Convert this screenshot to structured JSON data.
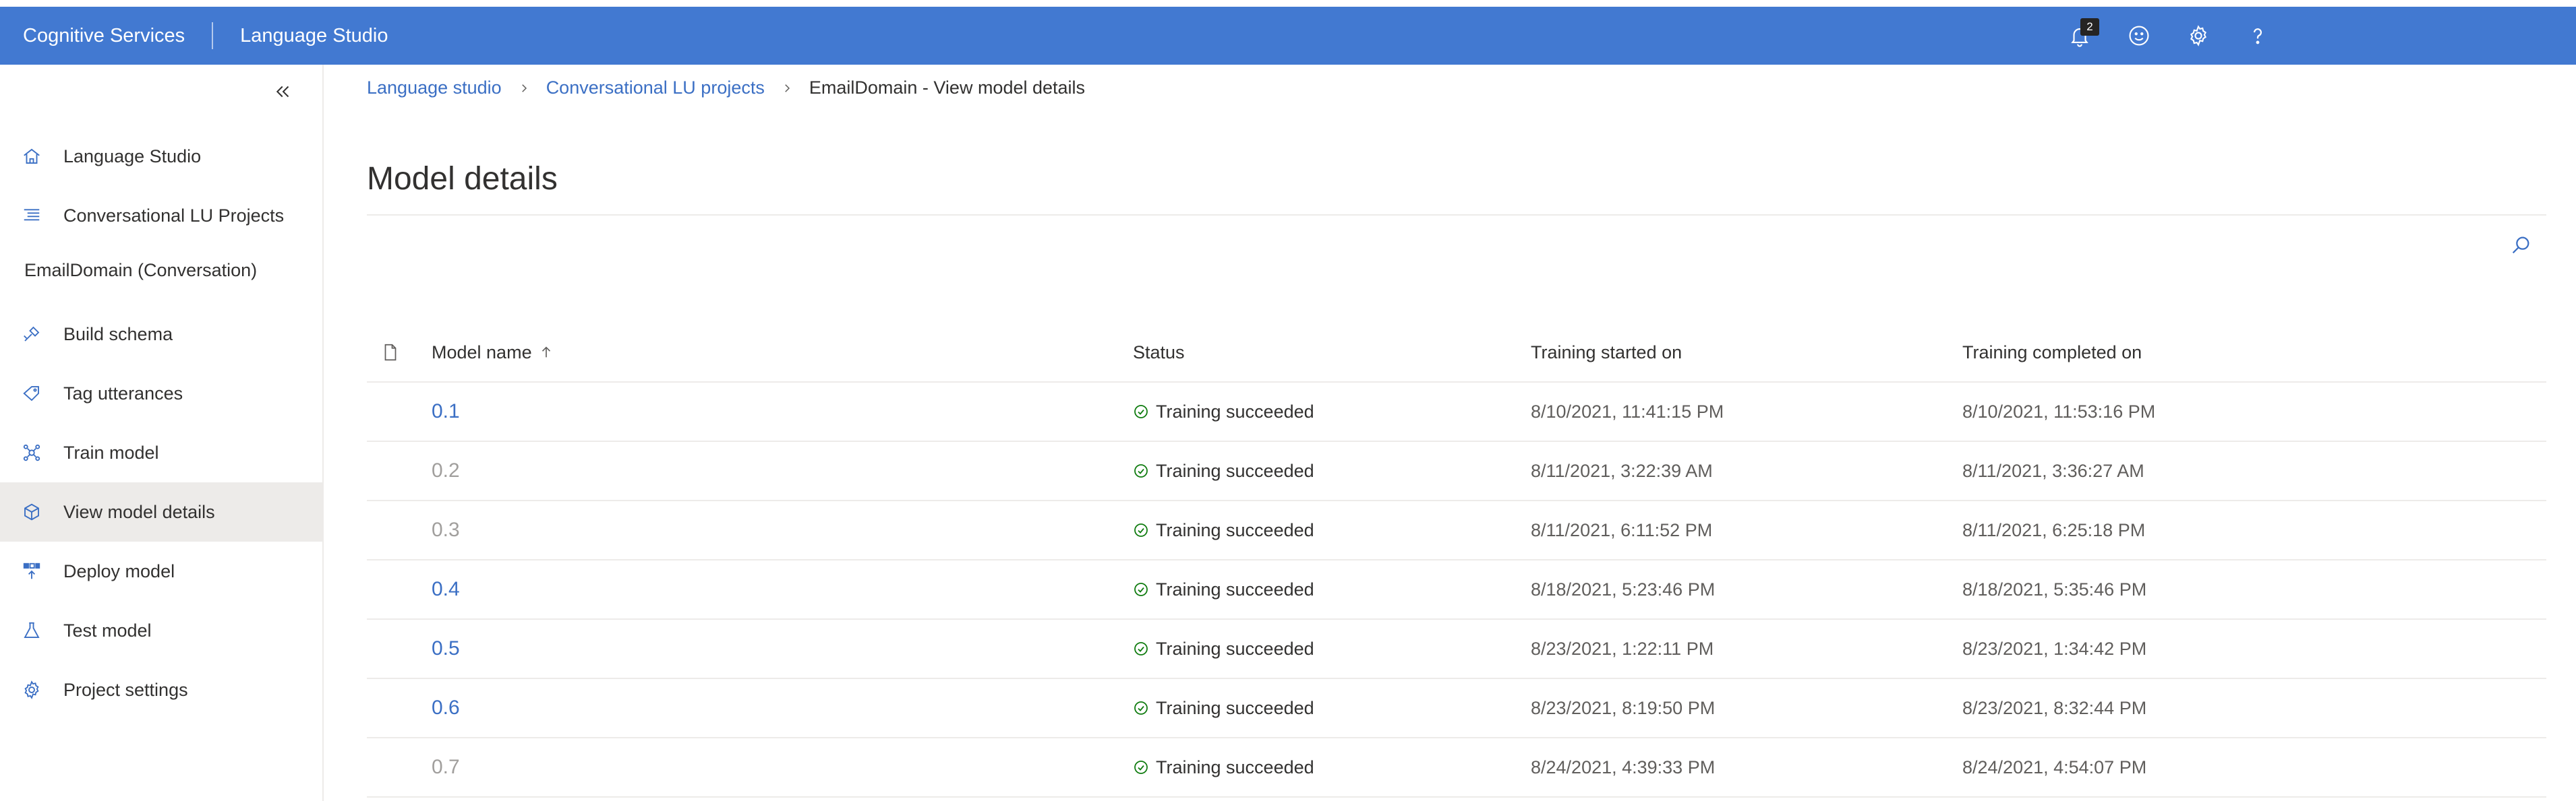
{
  "header": {
    "brand": "Cognitive Services",
    "product": "Language Studio",
    "notifications_count": "2",
    "bg_color": "#4279d1",
    "icons": [
      "bell-icon",
      "smiley-icon",
      "gear-icon",
      "help-icon"
    ]
  },
  "sidebar": {
    "collapse_icon": "double-chevron-left-icon",
    "top_items": [
      {
        "label": "Language Studio",
        "icon": "home-icon"
      },
      {
        "label": "Conversational LU Projects",
        "icon": "list-icon"
      }
    ],
    "section_title": "EmailDomain (Conversation)",
    "items": [
      {
        "label": "Build schema",
        "icon": "build-icon"
      },
      {
        "label": "Tag utterances",
        "icon": "tag-icon"
      },
      {
        "label": "Train model",
        "icon": "train-icon"
      },
      {
        "label": "View model details",
        "icon": "cube-icon",
        "active": true
      },
      {
        "label": "Deploy model",
        "icon": "deploy-icon"
      },
      {
        "label": "Test model",
        "icon": "flask-icon"
      },
      {
        "label": "Project settings",
        "icon": "gear-icon"
      }
    ]
  },
  "breadcrumb": {
    "items": [
      "Language studio",
      "Conversational LU projects"
    ],
    "current": "EmailDomain - View model details"
  },
  "page": {
    "title": "Model details"
  },
  "table": {
    "columns": {
      "name": "Model name",
      "status": "Status",
      "started": "Training started on",
      "completed": "Training completed on"
    },
    "sort_icon": "arrow-up-icon",
    "rows": [
      {
        "name": "0.1",
        "status": "Training succeeded",
        "started": "8/10/2021, 11:41:15 PM",
        "completed": "8/10/2021, 11:53:16 PM",
        "muted": false
      },
      {
        "name": "0.2",
        "status": "Training succeeded",
        "started": "8/11/2021, 3:22:39 AM",
        "completed": "8/11/2021, 3:36:27 AM",
        "muted": true
      },
      {
        "name": "0.3",
        "status": "Training succeeded",
        "started": "8/11/2021, 6:11:52 PM",
        "completed": "8/11/2021, 6:25:18 PM",
        "muted": true
      },
      {
        "name": "0.4",
        "status": "Training succeeded",
        "started": "8/18/2021, 5:23:46 PM",
        "completed": "8/18/2021, 5:35:46 PM",
        "muted": false
      },
      {
        "name": "0.5",
        "status": "Training succeeded",
        "started": "8/23/2021, 1:22:11 PM",
        "completed": "8/23/2021, 1:34:42 PM",
        "muted": false
      },
      {
        "name": "0.6",
        "status": "Training succeeded",
        "started": "8/23/2021, 8:19:50 PM",
        "completed": "8/23/2021, 8:32:44 PM",
        "muted": false
      },
      {
        "name": "0.7",
        "status": "Training succeeded",
        "started": "8/24/2021, 4:39:33 PM",
        "completed": "8/24/2021, 4:54:07 PM",
        "muted": true
      }
    ]
  },
  "colors": {
    "link": "#3b6fc4",
    "success": "#107c10",
    "muted": "#a19f9d"
  }
}
